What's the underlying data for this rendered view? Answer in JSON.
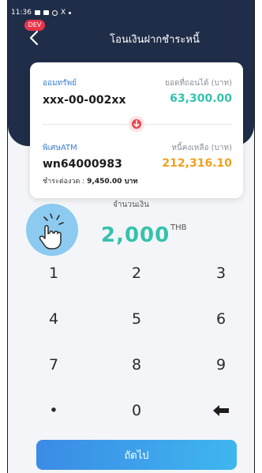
{
  "status_bar": {
    "time": "11:36"
  },
  "dev_badge": "DEV",
  "header": {
    "title": "โอนเงินฝากชำระหนี้"
  },
  "from_account": {
    "label": "ออมทรัพย์",
    "number": "xxx-00-002xx",
    "balance_label": "ยอดที่ถอนได้ (บาท)",
    "balance": "63,300.00",
    "balance_color": "#36c2ac"
  },
  "to_account": {
    "label": "พิเศษATM",
    "number": "wn64000983",
    "debt_label": "หนี้คงเหลือ (บาท)",
    "debt": "212,316.10",
    "debt_color": "#f0a020",
    "installment_label": "ชำระต่องวด :",
    "installment_value": "9,450.00 บาท"
  },
  "amount": {
    "label": "จำนวนเงิน",
    "value": "2,000",
    "currency": "THB"
  },
  "keypad": {
    "keys": [
      "1",
      "2",
      "3",
      "4",
      "5",
      "6",
      "7",
      "8",
      "9",
      "•",
      "0"
    ]
  },
  "next_button": {
    "label": "ถัดไป"
  }
}
